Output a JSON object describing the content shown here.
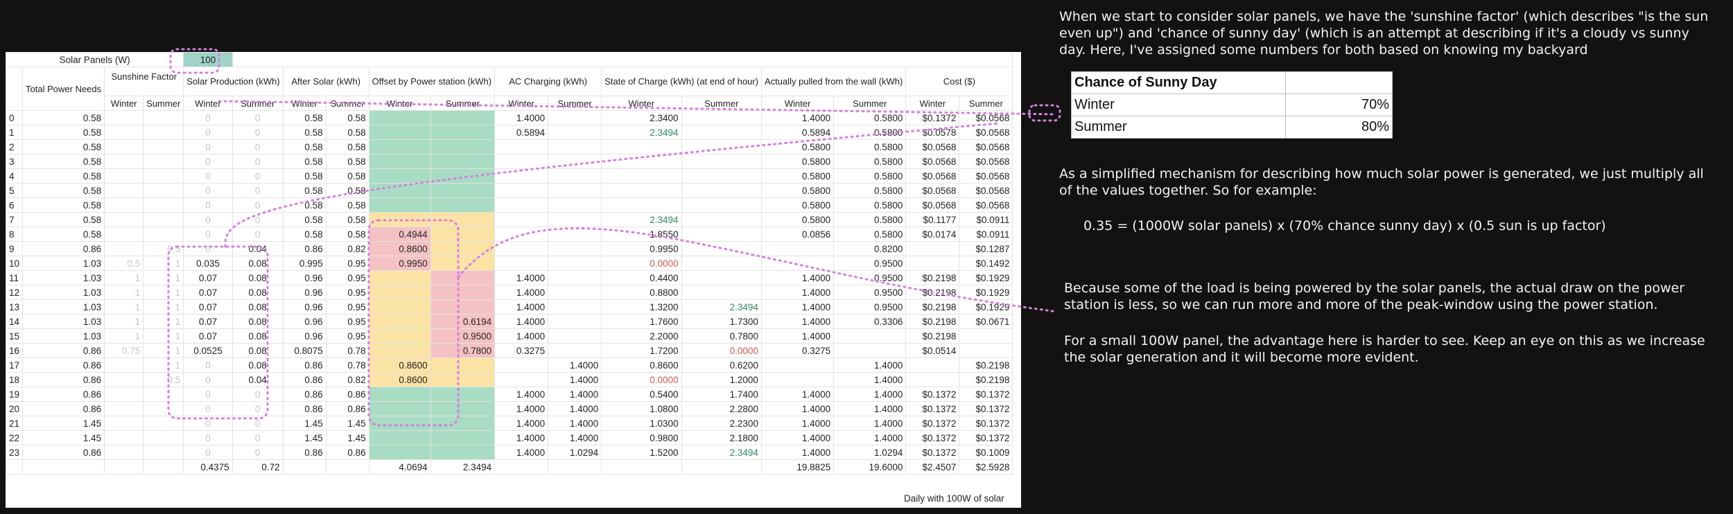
{
  "sheet": {
    "solar_panels_label": "Solar Panels (W)",
    "solar_panels_value": "100",
    "headers": {
      "total_power": "Total Power Needs",
      "sunshine": "Sunshine Factor",
      "solar_prod": "Solar Production (kWh)",
      "after_solar": "After Solar (kWh)",
      "offset": "Offset by Power station (kWh)",
      "ac": "AC Charging (kWh)",
      "soc": "State of Charge (kWh) (at end of hour)",
      "pulled": "Actually pulled from the wall (kWh)",
      "cost": "Cost ($)"
    },
    "winter": "Winter",
    "summer": "Summer",
    "rows": [
      [
        "0",
        "0.58",
        "",
        "",
        "0",
        "0",
        "0.58",
        "0.58",
        "",
        "",
        "1.4000",
        "",
        "2.3400",
        "",
        "1.4000",
        "0.5800",
        "$0.1372",
        "$0.0568"
      ],
      [
        "1",
        "0.58",
        "",
        "",
        "0",
        "0",
        "0.58",
        "0.58",
        "",
        "",
        "0.5894",
        "",
        "2.3494",
        "",
        "0.5894",
        "0.5800",
        "$0.0578",
        "$0.0568"
      ],
      [
        "2",
        "0.58",
        "",
        "",
        "0",
        "0",
        "0.58",
        "0.58",
        "",
        "",
        "",
        "",
        "",
        "",
        "0.5800",
        "0.5800",
        "$0.0568",
        "$0.0568"
      ],
      [
        "3",
        "0.58",
        "",
        "",
        "0",
        "0",
        "0.58",
        "0.58",
        "",
        "",
        "",
        "",
        "",
        "",
        "0.5800",
        "0.5800",
        "$0.0568",
        "$0.0568"
      ],
      [
        "4",
        "0.58",
        "",
        "",
        "0",
        "0",
        "0.58",
        "0.58",
        "",
        "",
        "",
        "",
        "",
        "",
        "0.5800",
        "0.5800",
        "$0.0568",
        "$0.0568"
      ],
      [
        "5",
        "0.58",
        "",
        "",
        "0",
        "0",
        "0.58",
        "0.58",
        "",
        "",
        "",
        "",
        "",
        "",
        "0.5800",
        "0.5800",
        "$0.0568",
        "$0.0568"
      ],
      [
        "6",
        "0.58",
        "",
        "",
        "0",
        "0",
        "0.58",
        "0.58",
        "",
        "",
        "",
        "",
        "",
        "",
        "0.5800",
        "0.5800",
        "$0.0568",
        "$0.0568"
      ],
      [
        "7",
        "0.58",
        "",
        "",
        "0",
        "0",
        "0.58",
        "0.58",
        "",
        "",
        "",
        "",
        "2.3494",
        "",
        "0.5800",
        "0.5800",
        "$0.1177",
        "$0.0911"
      ],
      [
        "8",
        "0.58",
        "",
        "",
        "0",
        "0",
        "0.58",
        "0.58",
        "0.4944",
        "",
        "",
        "",
        "1.8550",
        "",
        "0.0856",
        "0.5800",
        "$0.0174",
        "$0.0911"
      ],
      [
        "9",
        "0.86",
        "",
        "0.5",
        "0",
        "0.04",
        "0.86",
        "0.82",
        "0.8600",
        "",
        "",
        "",
        "0.9950",
        "",
        "",
        "0.8200",
        "",
        "$0.1287"
      ],
      [
        "10",
        "1.03",
        "0.5",
        "1",
        "0.035",
        "0.08",
        "0.995",
        "0.95",
        "0.9950",
        "",
        "",
        "",
        "0.0000",
        "",
        "",
        "0.9500",
        "",
        "$0.1492"
      ],
      [
        "11",
        "1.03",
        "1",
        "1",
        "0.07",
        "0.08",
        "0.96",
        "0.95",
        "",
        "",
        "1.4000",
        "",
        "0.4400",
        "",
        "1.4000",
        "0.9500",
        "$0.2198",
        "$0.1929"
      ],
      [
        "12",
        "1.03",
        "1",
        "1",
        "0.07",
        "0.08",
        "0.96",
        "0.95",
        "",
        "",
        "1.4000",
        "",
        "0.8800",
        "",
        "1.4000",
        "0.9500",
        "$0.2198",
        "$0.1929"
      ],
      [
        "13",
        "1.03",
        "1",
        "1",
        "0.07",
        "0.08",
        "0.96",
        "0.95",
        "",
        "",
        "1.4000",
        "",
        "1.3200",
        "2.3494",
        "1.4000",
        "0.9500",
        "$0.2198",
        "$0.1929"
      ],
      [
        "14",
        "1.03",
        "1",
        "1",
        "0.07",
        "0.08",
        "0.96",
        "0.95",
        "",
        "0.6194",
        "1.4000",
        "",
        "1.7600",
        "1.7300",
        "1.4000",
        "0.3306",
        "$0.2198",
        "$0.0671"
      ],
      [
        "15",
        "1.03",
        "1",
        "1",
        "0.07",
        "0.08",
        "0.96",
        "0.95",
        "",
        "0.9500",
        "1.4000",
        "",
        "2.2000",
        "0.7800",
        "1.4000",
        "",
        "$0.2198",
        ""
      ],
      [
        "16",
        "0.86",
        "0.75",
        "1",
        "0.0525",
        "0.08",
        "0.8075",
        "0.78",
        "",
        "0.7800",
        "0.3275",
        "",
        "1.7200",
        "0.0000",
        "0.3275",
        "",
        "$0.0514",
        ""
      ],
      [
        "17",
        "0.86",
        "",
        "1",
        "0",
        "0.08",
        "0.86",
        "0.78",
        "0.8600",
        "",
        "",
        "1.4000",
        "0.8600",
        "0.6200",
        "",
        "1.4000",
        "",
        "$0.2198"
      ],
      [
        "18",
        "0.86",
        "",
        "0.5",
        "0",
        "0.04",
        "0.86",
        "0.82",
        "0.8600",
        "",
        "",
        "1.4000",
        "0.0000",
        "1.2000",
        "",
        "1.4000",
        "",
        "$0.2198"
      ],
      [
        "19",
        "0.86",
        "",
        "",
        "0",
        "0",
        "0.86",
        "0.86",
        "",
        "",
        "1.4000",
        "1.4000",
        "0.5400",
        "1.7400",
        "1.4000",
        "1.4000",
        "$0.1372",
        "$0.1372"
      ],
      [
        "20",
        "0.86",
        "",
        "",
        "0",
        "0",
        "0.86",
        "0.86",
        "",
        "",
        "1.4000",
        "1.4000",
        "1.0800",
        "2.2800",
        "1.4000",
        "1.4000",
        "$0.1372",
        "$0.1372"
      ],
      [
        "21",
        "1.45",
        "",
        "",
        "0",
        "0",
        "1.45",
        "1.45",
        "",
        "",
        "1.4000",
        "1.4000",
        "1.0300",
        "2.2300",
        "1.4000",
        "1.4000",
        "$0.1372",
        "$0.1372"
      ],
      [
        "22",
        "1.45",
        "",
        "",
        "0",
        "0",
        "1.45",
        "1.45",
        "",
        "",
        "1.4000",
        "1.4000",
        "0.9800",
        "2.1800",
        "1.4000",
        "1.4000",
        "$0.1372",
        "$0.1372"
      ],
      [
        "23",
        "0.86",
        "",
        "",
        "0",
        "0",
        "0.86",
        "0.86",
        "",
        "",
        "1.4000",
        "1.0294",
        "1.5200",
        "2.3494",
        "1.4000",
        "1.0294",
        "$0.1372",
        "$0.1009"
      ]
    ],
    "totals": [
      "",
      "",
      "",
      "",
      "0.4375",
      "0.72",
      "",
      "",
      "4.0694",
      "2.3494",
      "",
      "",
      "",
      "",
      "19.8825",
      "19.6000",
      "$2.4507",
      "$2.5928"
    ],
    "totals_note": "Daily with 100W of solar"
  },
  "annotations": {
    "intro": "When we start to consider solar panels, we have the 'sunshine factor' (which describes \"is the sun even up\") and 'chance of sunny day' (which is an attempt at describing if it's a cloudy vs sunny day. Here, I've assigned some numbers for both based on knowing my backyard",
    "mechanism": "As a simplified mechanism for describing how much solar power is generated, we just multiply all of the values together. So for example:",
    "formula": "0.35 = (1000W solar panels) x (70% chance sunny day) x (0.5 sun is up factor)",
    "load": "Because some of the load is being powered by the solar panels, the actual draw on the power station is less, so we can run more and more of the peak-window using the power station.",
    "small_panel": "For a small 100W panel, the advantage here is harder to see. Keep an eye on this as we increase the solar generation and it will become more evident."
  },
  "sunny_table": {
    "title": "Chance of Sunny Day",
    "rows": [
      {
        "season": "Winter",
        "value": "70%"
      },
      {
        "season": "Summer",
        "value": "80%"
      }
    ]
  },
  "colors": {
    "highlight_green": "#a8dcc3",
    "highlight_yellow": "#fbe3a6",
    "highlight_red": "#f4c2c2",
    "annotation_dots": "#d67ee0"
  }
}
